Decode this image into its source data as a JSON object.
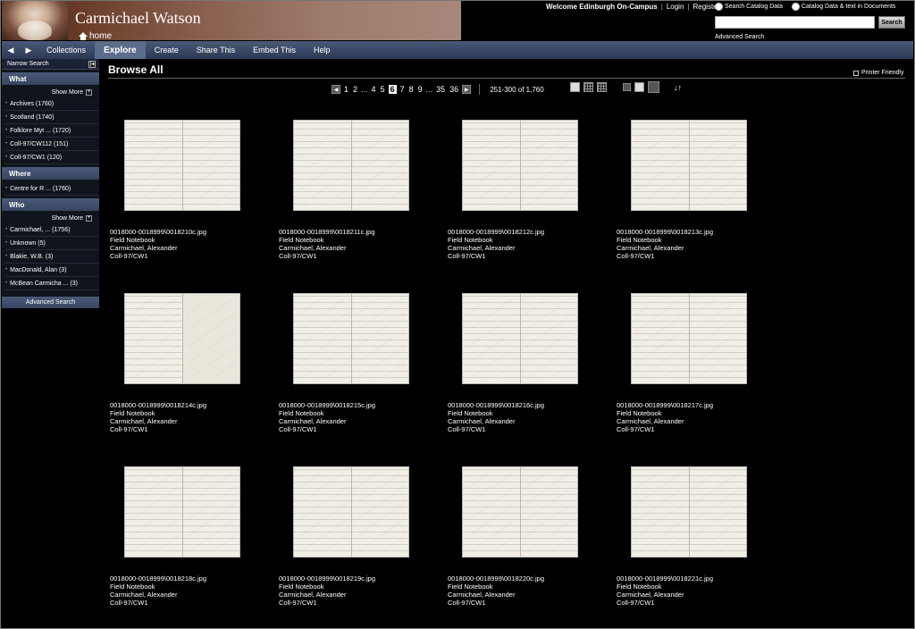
{
  "header": {
    "site_title": "Carmichael Watson",
    "home_label": "home",
    "welcome": "Welcome Edinburgh On-Campus",
    "login": "Login",
    "register": "Register",
    "search_option_1": "Search Catalog Data",
    "search_option_2": "Catalog Data & text in Documents",
    "search_button": "Search",
    "search_value": "",
    "advanced_search": "Advanced Search"
  },
  "nav": {
    "back_icon": "back-arrow-icon",
    "forward_icon": "forward-arrow-icon",
    "items": [
      "Collections",
      "Explore",
      "Create",
      "Share This",
      "Embed This",
      "Help"
    ],
    "active": "Explore"
  },
  "sidebar": {
    "narrow_search": "Narrow Search",
    "show_more": "Show More",
    "what": {
      "title": "What",
      "items": [
        "Archives (1760)",
        "Scotland (1740)",
        "Folklore Myt ... (1720)",
        "Coll-97/CW112 (151)",
        "Coll-97/CW1 (120)"
      ]
    },
    "where": {
      "title": "Where",
      "items": [
        "Centre for R ... (1760)"
      ]
    },
    "who": {
      "title": "Who",
      "items": [
        "Carmichael, ... (1756)",
        "Unknown (5)",
        "Blakie, W.B. (3)",
        "MacDonald, Alan (3)",
        "McBean Carmicha ... (3)"
      ]
    },
    "advanced_search": "Advanced Search"
  },
  "main": {
    "title": "Browse All",
    "printer_friendly": "Printer Friendly",
    "pager": {
      "pages": [
        "1",
        "2",
        "...",
        "4",
        "5",
        "6",
        "7",
        "8",
        "9",
        "...",
        "35",
        "36"
      ],
      "current": "6",
      "range": "251-300 of 1,760"
    },
    "items": [
      {
        "file": "0018000-0018999\\0018210c.jpg",
        "type": "Field Notebook",
        "creator": "Carmichael, Alexander",
        "collection": "Coll-97/CW1"
      },
      {
        "file": "0018000-0018999\\0018211c.jpg",
        "type": "Field Notebook",
        "creator": "Carmichael, Alexander",
        "collection": "Coll-97/CW1"
      },
      {
        "file": "0018000-0018999\\0018212c.jpg",
        "type": "Field Notebook",
        "creator": "Carmichael, Alexander",
        "collection": "Coll-97/CW1"
      },
      {
        "file": "0018000-0018999\\0018213c.jpg",
        "type": "Field Notebook",
        "creator": "Carmichael, Alexander",
        "collection": "Coll-97/CW1"
      },
      {
        "file": "0018000-0018999\\0018214c.jpg",
        "type": "Field Notebook",
        "creator": "Carmichael, Alexander",
        "collection": "Coll-97/CW1"
      },
      {
        "file": "0018000-0018999\\0018215c.jpg",
        "type": "Field Notebook",
        "creator": "Carmichael, Alexander",
        "collection": "Coll-97/CW1"
      },
      {
        "file": "0018000-0018999\\0018216c.jpg",
        "type": "Field Notebook",
        "creator": "Carmichael, Alexander",
        "collection": "Coll-97/CW1"
      },
      {
        "file": "0018000-0018999\\0018217c.jpg",
        "type": "Field Notebook",
        "creator": "Carmichael, Alexander",
        "collection": "Coll-97/CW1"
      },
      {
        "file": "0018000-0018999\\0018218c.jpg",
        "type": "Field Notebook",
        "creator": "Carmichael, Alexander",
        "collection": "Coll-97/CW1"
      },
      {
        "file": "0018000-0018999\\0018219c.jpg",
        "type": "Field Notebook",
        "creator": "Carmichael, Alexander",
        "collection": "Coll-97/CW1"
      },
      {
        "file": "0018000-0018999\\0018220c.jpg",
        "type": "Field Notebook",
        "creator": "Carmichael, Alexander",
        "collection": "Coll-97/CW1"
      },
      {
        "file": "0018000-0018999\\0018221c.jpg",
        "type": "Field Notebook",
        "creator": "Carmichael, Alexander",
        "collection": "Coll-97/CW1"
      }
    ]
  }
}
